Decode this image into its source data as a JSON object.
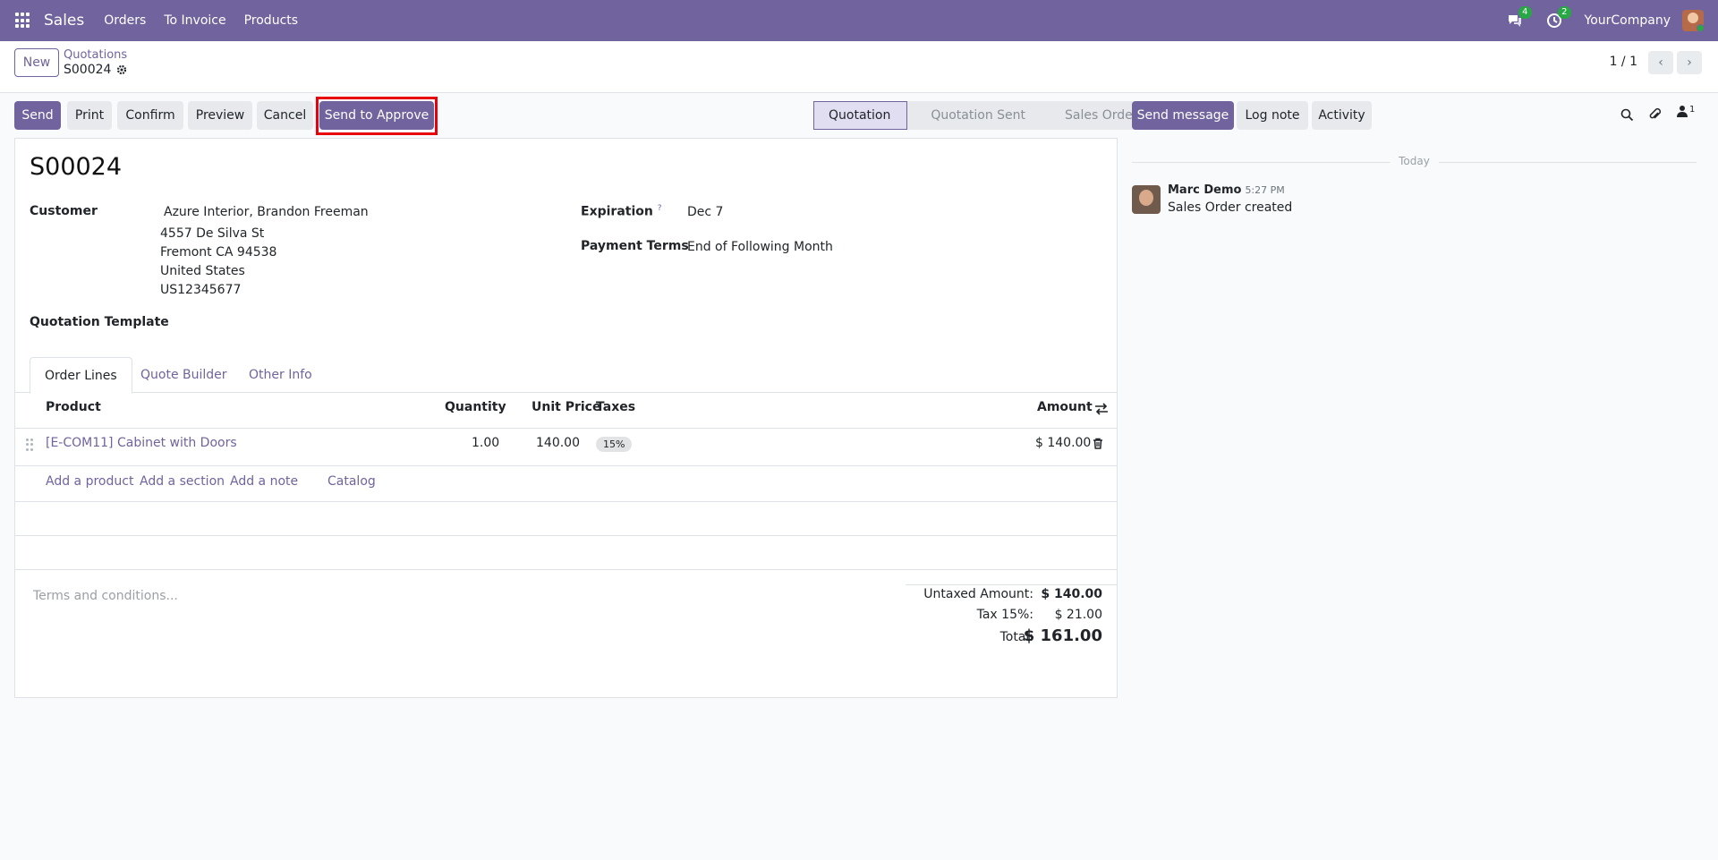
{
  "navbar": {
    "app_name": "Sales",
    "menu": [
      "Orders",
      "To Invoice",
      "Products"
    ],
    "messages_count": "4",
    "activities_count": "2",
    "company": "YourCompany"
  },
  "control": {
    "new_label": "New",
    "breadcrumb_parent": "Quotations",
    "breadcrumb_current": "S00024",
    "pager": "1 / 1"
  },
  "actions": {
    "send": "Send",
    "print": "Print",
    "confirm": "Confirm",
    "preview": "Preview",
    "cancel": "Cancel",
    "send_to_approve": "Send to Approve"
  },
  "statusbar": {
    "stages": [
      "Quotation",
      "Quotation Sent",
      "Sales Order"
    ],
    "active": "Quotation"
  },
  "form": {
    "title": "S00024",
    "customer_label": "Customer",
    "customer_name": "Azure Interior, Brandon Freeman",
    "customer_address": [
      "4557 De Silva St",
      "Fremont CA 94538",
      "United States",
      "US12345677"
    ],
    "expiration_label": "Expiration",
    "expiration_help": "?",
    "expiration_value": "Dec 7",
    "payment_terms_label": "Payment Terms",
    "payment_terms_value": "End of Following Month",
    "template_label": "Quotation Template",
    "tabs": [
      "Order Lines",
      "Quote Builder",
      "Other Info"
    ],
    "columns": {
      "product": "Product",
      "quantity": "Quantity",
      "unit_price": "Unit Price",
      "taxes": "Taxes",
      "amount": "Amount"
    },
    "lines": [
      {
        "product": "[E-COM11] Cabinet with Doors",
        "quantity": "1.00",
        "unit_price": "140.00",
        "tax": "15%",
        "amount": "$ 140.00"
      }
    ],
    "add_links": [
      "Add a product",
      "Add a section",
      "Add a note",
      "Catalog"
    ],
    "terms_placeholder": "Terms and conditions...",
    "totals": {
      "untaxed_label": "Untaxed Amount:",
      "untaxed_value": "$ 140.00",
      "tax_label": "Tax 15%:",
      "tax_value": "$ 21.00",
      "total_label": "Total:",
      "total_value": "$ 161.00"
    }
  },
  "chatter": {
    "send_message": "Send message",
    "log_note": "Log note",
    "activity": "Activity",
    "followers_count": "1",
    "date_separator": "Today",
    "messages": [
      {
        "author": "Marc Demo",
        "time": "5:27 PM",
        "body": "Sales Order created"
      }
    ]
  },
  "colors": {
    "brand": "#71639e",
    "highlight": "#e8000b",
    "badge": "#28a745"
  }
}
